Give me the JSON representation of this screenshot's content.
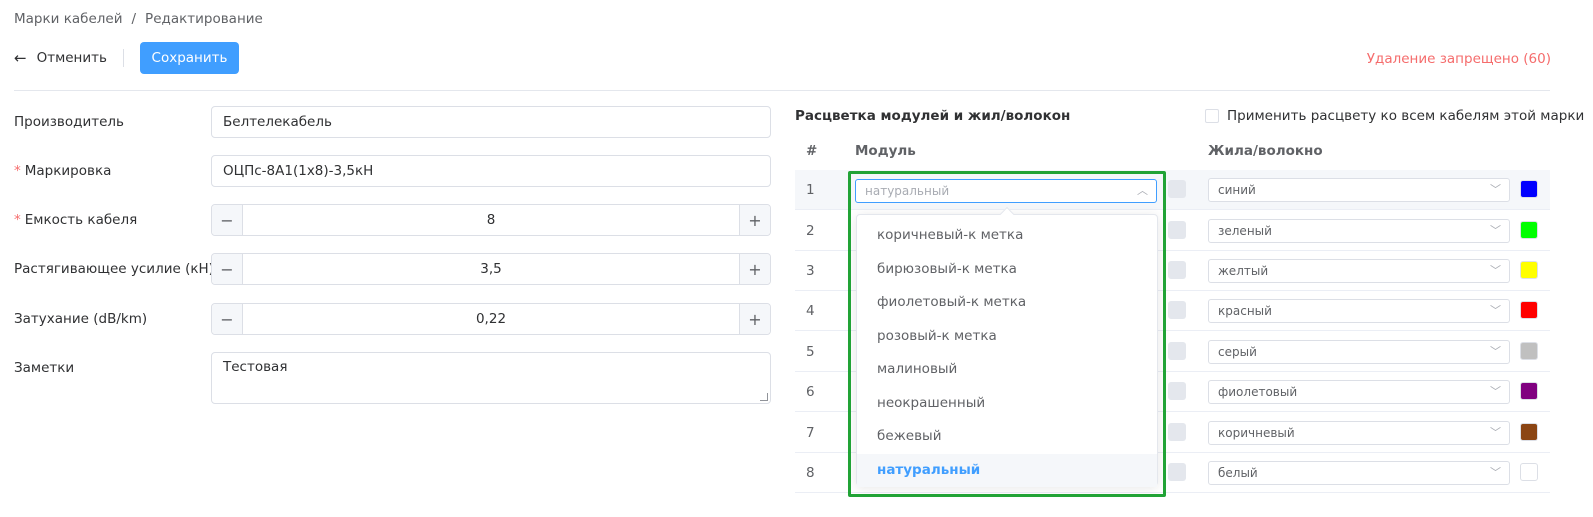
{
  "breadcrumb": {
    "parent": "Марки кабелей",
    "separator": "/",
    "current": "Редактирование"
  },
  "toolbar": {
    "cancel_label": "Отменить",
    "save_label": "Сохранить",
    "delete_warning": "Удаление запрещено (60)"
  },
  "form": {
    "manufacturer": {
      "label": "Производитель",
      "value": "Белтелекабель"
    },
    "marking": {
      "label": "Маркировка",
      "value": "ОЦПс-8А1(1х8)-3,5кН",
      "required": true
    },
    "capacity": {
      "label": "Емкость кабеля",
      "value": "8",
      "required": true
    },
    "tensile": {
      "label": "Растягивающее усилие (кН)",
      "value": "3,5"
    },
    "attenuation": {
      "label": "Затухание (dB/km)",
      "value": "0,22"
    },
    "notes": {
      "label": "Заметки",
      "value": "Тестовая"
    },
    "required_mark": "*",
    "minus": "−",
    "plus": "+"
  },
  "coloring": {
    "title": "Расцветка модулей и жил/волокон",
    "apply_all_label": "Применить расцвету ко всем кабелям этой марки",
    "headers": {
      "index": "#",
      "module": "Модуль",
      "fiber": "Жила/волокно"
    },
    "module_placeholder": "натуральный",
    "rows": [
      {
        "index": "1",
        "fiber": "синий",
        "color": "#0000ff"
      },
      {
        "index": "2",
        "fiber": "зеленый",
        "color": "#00ff00"
      },
      {
        "index": "3",
        "fiber": "желтый",
        "color": "#ffff00"
      },
      {
        "index": "4",
        "fiber": "красный",
        "color": "#ff0000"
      },
      {
        "index": "5",
        "fiber": "серый",
        "color": "#c0c0c0"
      },
      {
        "index": "6",
        "fiber": "фиолетовый",
        "color": "#800080"
      },
      {
        "index": "7",
        "fiber": "коричневый",
        "color": "#8b4513"
      },
      {
        "index": "8",
        "fiber": "белый",
        "color": "#ffffff"
      }
    ],
    "dropdown_options": [
      "коричневый-к метка",
      "бирюзовый-к метка",
      "фиолетовый-к метка",
      "розовый-к метка",
      "малиновый",
      "неокрашенный",
      "бежевый",
      "натуральный"
    ],
    "selected_option": "натуральный"
  },
  "icons": {
    "back": "arrow-left-icon",
    "chevron_down": "chevron-down-icon",
    "chevron_up": "chevron-up-icon"
  }
}
